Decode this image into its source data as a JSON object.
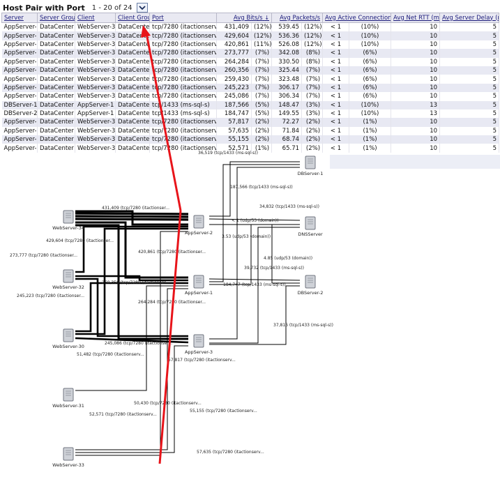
{
  "header": {
    "title": "Host Pair with Port",
    "pager": "1 - 20 of 24"
  },
  "table": {
    "columns": [
      "Server",
      "Server Group",
      "Client",
      "Client Group",
      "Port",
      "Avg Bits/s",
      "Avg Packets/s",
      "Avg Active Connections/s",
      "Avg Net RTT (ms)",
      "Avg Server Delay (ms)"
    ],
    "sort_indicator": "↓",
    "rows": [
      [
        "AppServer-2",
        "DataCenter",
        "WebServer-34",
        "DataCenter",
        "tcp/7280 (itactionserver1)",
        "431,409",
        "(12%)",
        "539.45",
        "(12%)",
        "< 1",
        "(10%)",
        "10",
        "5"
      ],
      [
        "AppServer-3",
        "DataCenter",
        "WebServer-34",
        "DataCenter",
        "tcp/7280 (itactionserver1)",
        "429,604",
        "(12%)",
        "536.36",
        "(12%)",
        "< 1",
        "(10%)",
        "10",
        "5"
      ],
      [
        "AppServer-1",
        "DataCenter",
        "WebServer-34",
        "DataCenter",
        "tcp/7280 (itactionserver1)",
        "420,861",
        "(11%)",
        "526.08",
        "(12%)",
        "< 1",
        "(10%)",
        "10",
        "5"
      ],
      [
        "AppServer-2",
        "DataCenter",
        "WebServer-32",
        "DataCenter",
        "tcp/7280 (itactionserver1)",
        "273,777",
        "(7%)",
        "342.08",
        "(8%)",
        "< 1",
        "(6%)",
        "10",
        "5"
      ],
      [
        "AppServer-1",
        "DataCenter",
        "WebServer-30",
        "DataCenter",
        "tcp/7280 (itactionserver1)",
        "264,284",
        "(7%)",
        "330.50",
        "(8%)",
        "< 1",
        "(6%)",
        "10",
        "5"
      ],
      [
        "AppServer-1",
        "DataCenter",
        "WebServer-32",
        "DataCenter",
        "tcp/7280 (itactionserver1)",
        "260,356",
        "(7%)",
        "325.44",
        "(7%)",
        "< 1",
        "(6%)",
        "10",
        "5"
      ],
      [
        "AppServer-3",
        "DataCenter",
        "WebServer-32",
        "DataCenter",
        "tcp/7280 (itactionserver1)",
        "259,430",
        "(7%)",
        "323.48",
        "(7%)",
        "< 1",
        "(6%)",
        "10",
        "5"
      ],
      [
        "AppServer-2",
        "DataCenter",
        "WebServer-30",
        "DataCenter",
        "tcp/7280 (itactionserver1)",
        "245,223",
        "(7%)",
        "306.17",
        "(7%)",
        "< 1",
        "(6%)",
        "10",
        "5"
      ],
      [
        "AppServer-3",
        "DataCenter",
        "WebServer-30",
        "DataCenter",
        "tcp/7280 (itactionserver1)",
        "245,086",
        "(7%)",
        "306.34",
        "(7%)",
        "< 1",
        "(6%)",
        "10",
        "5"
      ],
      [
        "DBServer-1",
        "DataCenter",
        "AppServer-1",
        "DataCenter",
        "tcp/1433 (ms-sql-s)",
        "187,566",
        "(5%)",
        "148.47",
        "(3%)",
        "< 1",
        "(10%)",
        "13",
        "5"
      ],
      [
        "DBServer-2",
        "DataCenter",
        "AppServer-1",
        "DataCenter",
        "tcp/1433 (ms-sql-s)",
        "184,747",
        "(5%)",
        "149.55",
        "(3%)",
        "< 1",
        "(10%)",
        "13",
        "5"
      ],
      [
        "AppServer-1",
        "DataCenter",
        "WebServer-31",
        "DataCenter",
        "tcp/7280 (itactionserver1)",
        "57,817",
        "(2%)",
        "72.27",
        "(2%)",
        "< 1",
        "(1%)",
        "10",
        "5"
      ],
      [
        "AppServer-3",
        "DataCenter",
        "WebServer-33",
        "DataCenter",
        "tcp/7280 (itactionserver1)",
        "57,635",
        "(2%)",
        "71.84",
        "(2%)",
        "< 1",
        "(1%)",
        "10",
        "5"
      ],
      [
        "AppServer-1",
        "DataCenter",
        "WebServer-33",
        "DataCenter",
        "tcp/7280 (itactionserver1)",
        "55,155",
        "(2%)",
        "68.74",
        "(2%)",
        "< 1",
        "(1%)",
        "10",
        "5"
      ],
      [
        "AppServer-2",
        "DataCenter",
        "WebServer-33",
        "DataCenter",
        "tcp/7280 (itactionserver1)",
        "52,571",
        "(1%)",
        "65.71",
        "(2%)",
        "< 1",
        "(1%)",
        "10",
        "5"
      ]
    ]
  },
  "diagram": {
    "nodes": {
      "webserver34": "WebServer-34",
      "webserver32": "WebServer-32",
      "webserver30": "WebServer-30",
      "webserver31": "WebServer-31",
      "webserver33": "WebServer-33",
      "appserver2": "AppServer-2",
      "appserver1": "AppServer-1",
      "appserver3": "AppServer-3",
      "dbserver1": "DBServer-1",
      "dnsserver": "DNSServer",
      "dbserver2": "DBServer-2"
    },
    "edge_labels": {
      "e1": "36,519 (tcp/1433 (ms-sql-s))",
      "e2": "187,566 (tcp/1433 (ms-sql-s))",
      "e3": "431,409 (tcp/7280 (itactionser...",
      "e4": "34,832 (tcp/1433 (ms-sql-s))",
      "e5": "< 1 (udp/53 (domain))",
      "e6": "429,604 (tcp/7280 (itactionser...",
      "e7": "3.53 (udp/53 (domain))",
      "e8": "420,861 (tcp/7280 (itactionser...",
      "e9": "273,777 (tcp/7280 (itactionser...",
      "e10": "4.85 (udp/53 (domain))",
      "e11": "39,732 (tcp/1433 (ms-sql-s))",
      "e12": "260,356 (tcp/7280 (itactionser...",
      "e13": "184,747 (tcp/1433 (ms-sql-s))",
      "e14": "245,223 (tcp/7280 (itactionser...",
      "e15": "264,284 (tcp/7280 (itactionser...",
      "e16": "37,816 (tcp/1433 (ms-sql-s))",
      "e17": "245,086 (tcp/7280 (itactionser...",
      "e18": "51,482 (tcp/7280 (itactionserv...",
      "e19": "57,817 (tcp/7280 (itactionserv...",
      "e20": "50,430 (tcp/7280 (itactionserv...",
      "e21": "55,155 (tcp/7280 (itactionserv...",
      "e22": "52,571 (tcp/7280 (itactionserv...",
      "e23": "57,635 (tcp/7280 (itactionserv..."
    }
  },
  "colors": {
    "annotation_arrow": "#e8141a",
    "header_bg": "#e9e9f2",
    "row_alt": "#e8e9f3"
  },
  "icons": {
    "pager": "chevron-down-icon",
    "server": "server-icon"
  }
}
